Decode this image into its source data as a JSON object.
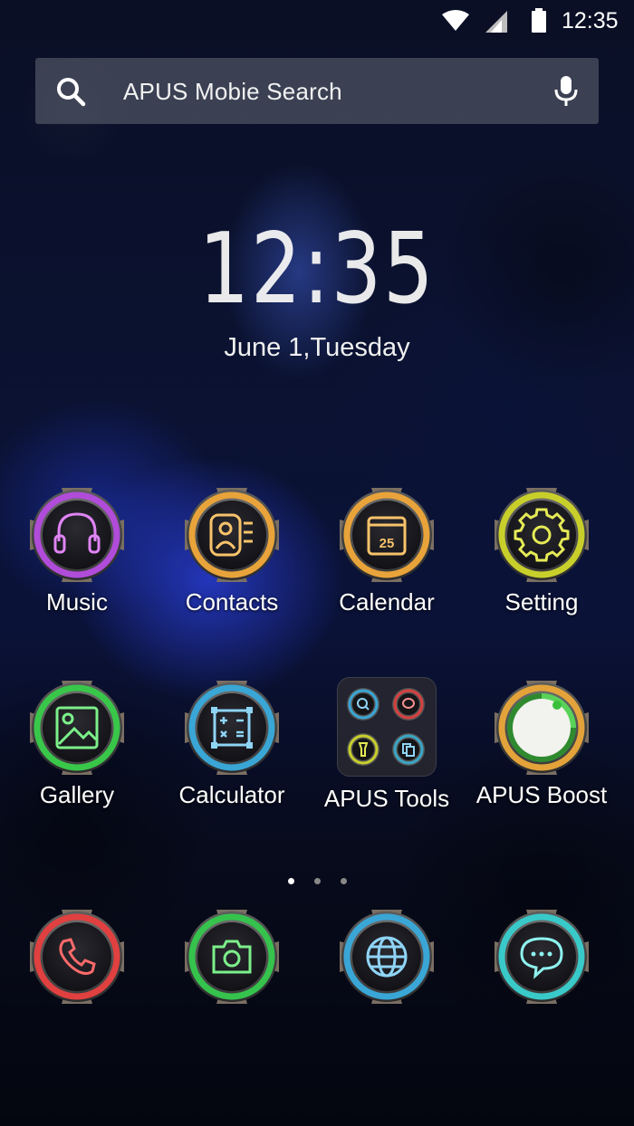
{
  "status_bar": {
    "time": "12:35",
    "icons": [
      "wifi-icon",
      "cell-signal-icon",
      "battery-icon"
    ]
  },
  "search": {
    "placeholder": "APUS Mobie Search",
    "icons": [
      "search-icon",
      "microphone-icon"
    ]
  },
  "clock": {
    "time": "12:35",
    "date": "June 1,Tuesday"
  },
  "apps": [
    {
      "label": "Music",
      "icon": "headphones-icon",
      "color": "#b04cd9"
    },
    {
      "label": "Contacts",
      "icon": "contact-card-icon",
      "color": "#e8a33a"
    },
    {
      "label": "Calendar",
      "icon": "calendar-icon",
      "color": "#e8a33a",
      "day": "25"
    },
    {
      "label": "Setting",
      "icon": "gear-icon",
      "color": "#c8cf2a"
    },
    {
      "label": "Gallery",
      "icon": "image-icon",
      "color": "#39c74a"
    },
    {
      "label": "Calculator",
      "icon": "calculator-icon",
      "color": "#3aa6d6"
    },
    {
      "label": "APUS Tools",
      "icon": "folder-icon"
    },
    {
      "label": "APUS Boost",
      "icon": "boost-icon",
      "color": "#e3a33a"
    }
  ],
  "page_indicator": {
    "pages": 3,
    "active": 1
  },
  "dock": [
    {
      "icon": "phone-icon",
      "color": "#e04040"
    },
    {
      "icon": "camera-icon",
      "color": "#35c34d"
    },
    {
      "icon": "globe-icon",
      "color": "#3aa6d6"
    },
    {
      "icon": "chat-bubble-icon",
      "color": "#3ac9c9"
    }
  ]
}
